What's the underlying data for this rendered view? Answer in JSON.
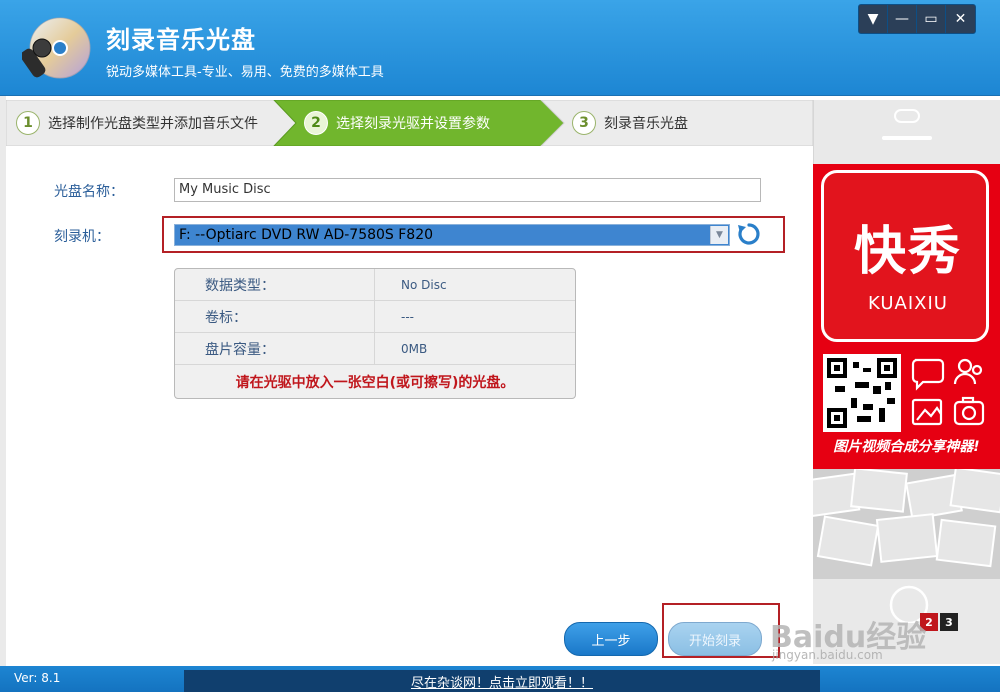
{
  "app": {
    "title": "刻录音乐光盘",
    "subtitle": "锐动多媒体工具-专业、易用、免费的多媒体工具"
  },
  "window_controls": [
    "▼",
    "—",
    "▭",
    "✕"
  ],
  "steps": [
    {
      "num": "1",
      "label": "选择制作光盘类型并添加音乐文件"
    },
    {
      "num": "2",
      "label": "选择刻录光驱并设置参数"
    },
    {
      "num": "3",
      "label": "刻录音乐光盘"
    }
  ],
  "form": {
    "disc_name_label": "光盘名称：",
    "disc_name_value": "My Music Disc",
    "burner_label": "刻录机：",
    "burner_value": "F:  --Optiarc DVD RW AD-7580S  F820"
  },
  "info": {
    "rows": [
      {
        "key": "数据类型：",
        "value": "No Disc"
      },
      {
        "key": "卷标：",
        "value": "---"
      },
      {
        "key": "盘片容量：",
        "value": "0MB"
      }
    ],
    "message": "请在光驱中放入一张空白(或可擦写)的光盘。"
  },
  "buttons": {
    "prev": "上一步",
    "start": "开始刻录"
  },
  "ad": {
    "logo_cn": "快秀",
    "logo_en": "KUAIXIU",
    "slogan": "图片视频合成分享神器!",
    "pager": [
      "2",
      "3"
    ]
  },
  "watermark": {
    "text": "Baidu经验",
    "sub": "jingyan.baidu.com"
  },
  "footer": {
    "version": "Ver: 8.1",
    "ad_link": "尽在杂谈网！点击立即观看！！"
  },
  "colors": {
    "header_blue": "#1d86d3",
    "step_active_green": "#6cb52a",
    "highlight_red": "#b42025",
    "ad_red": "#e60012"
  }
}
